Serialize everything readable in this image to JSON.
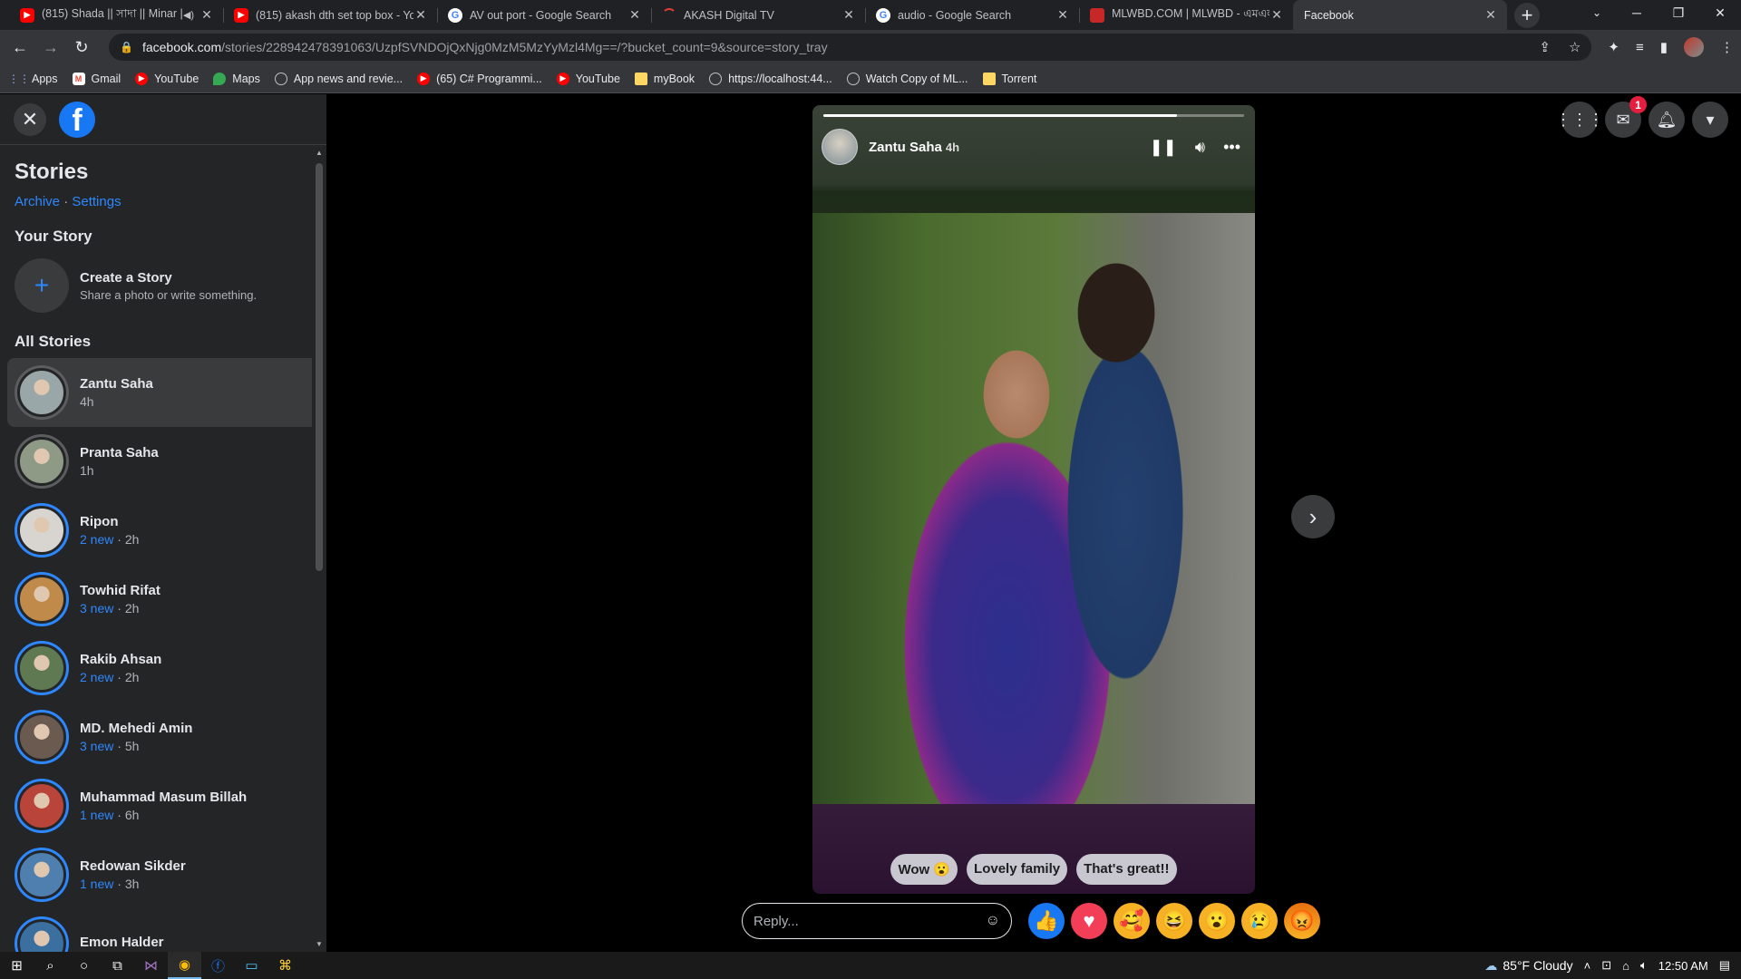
{
  "browser": {
    "tabs": [
      {
        "title": "(815) Shada || সাদা || Minar |",
        "favicon": "yt",
        "audio": true,
        "active": false
      },
      {
        "title": "(815) akash dth set top box - Yo",
        "favicon": "yt",
        "audio": false,
        "active": false
      },
      {
        "title": "AV out port - Google Search",
        "favicon": "g",
        "audio": false,
        "active": false
      },
      {
        "title": "AKASH Digital TV",
        "favicon": "akash",
        "audio": false,
        "active": false
      },
      {
        "title": "audio - Google Search",
        "favicon": "g",
        "audio": false,
        "active": false
      },
      {
        "title": "MLWBD.COM | MLWBD - এমএল",
        "favicon": "mlw",
        "audio": false,
        "active": false
      },
      {
        "title": "Facebook",
        "favicon": "fb",
        "audio": false,
        "active": true
      }
    ],
    "url_host": "facebook.com",
    "url_path": "/stories/228942478391063/UzpfSVNDOjQxNjg0MzM5MzYyMzl4Mg==/?bucket_count=9&source=story_tray",
    "bookmarks": [
      {
        "label": "Apps",
        "icon": "apps"
      },
      {
        "label": "Gmail",
        "icon": "gm"
      },
      {
        "label": "YouTube",
        "icon": "yt"
      },
      {
        "label": "Maps",
        "icon": "maps"
      },
      {
        "label": "App news and revie...",
        "icon": "globe"
      },
      {
        "label": "(65) C# Programmi...",
        "icon": "yt"
      },
      {
        "label": "YouTube",
        "icon": "yt"
      },
      {
        "label": "myBook",
        "icon": "folder"
      },
      {
        "label": "https://localhost:44...",
        "icon": "globe"
      },
      {
        "label": "Watch Copy of ML...",
        "icon": "globe"
      },
      {
        "label": "Torrent",
        "icon": "folder"
      }
    ]
  },
  "sidebar": {
    "title": "Stories",
    "archive": "Archive",
    "separator": "·",
    "settings": "Settings",
    "your_story": "Your Story",
    "create_title": "Create a Story",
    "create_sub": "Share a photo or write something.",
    "all_stories": "All Stories",
    "stories": [
      {
        "name": "Zantu Saha",
        "new": "",
        "time": "4h",
        "seen": true,
        "active": true,
        "color": "#9aa7a8"
      },
      {
        "name": "Pranta Saha",
        "new": "",
        "time": "1h",
        "seen": true,
        "active": false,
        "color": "#8f9a86"
      },
      {
        "name": "Ripon",
        "new": "2 new",
        "time": "2h",
        "seen": false,
        "active": false,
        "color": "#d8d4cf"
      },
      {
        "name": "Towhid Rifat",
        "new": "3 new",
        "time": "2h",
        "seen": false,
        "active": false,
        "color": "#c08a4a"
      },
      {
        "name": "Rakib Ahsan",
        "new": "2 new",
        "time": "2h",
        "seen": false,
        "active": false,
        "color": "#5f7a52"
      },
      {
        "name": "MD. Mehedi Amin",
        "new": "3 new",
        "time": "5h",
        "seen": false,
        "active": false,
        "color": "#6a5a4f"
      },
      {
        "name": "Muhammad Masum Billah",
        "new": "1 new",
        "time": "6h",
        "seen": false,
        "active": false,
        "color": "#b8443a"
      },
      {
        "name": "Redowan Sikder",
        "new": "1 new",
        "time": "3h",
        "seen": false,
        "active": false,
        "color": "#4f7fae"
      },
      {
        "name": "Emon Halder",
        "new": "",
        "time": "",
        "seen": false,
        "active": false,
        "color": "#3b6fa0"
      }
    ]
  },
  "viewer": {
    "author": "Zantu Saha",
    "time": "4h",
    "progress": 0.84,
    "suggestions": [
      "Wow 😮",
      "Lovely family",
      "That's great!!"
    ],
    "reply_placeholder": "Reply..."
  },
  "header": {
    "messenger_badge": "1"
  },
  "taskbar": {
    "weather": "85°F  Cloudy",
    "clock": "12:50 AM"
  }
}
